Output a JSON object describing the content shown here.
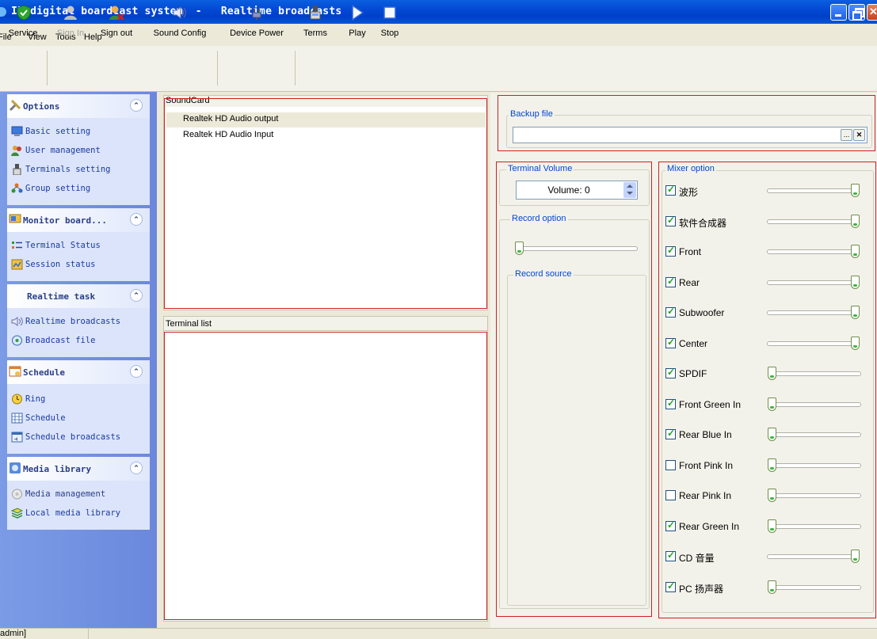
{
  "window": {
    "title": "IP digital boardcast system  -   Realtime broadcasts"
  },
  "menu": [
    "File",
    "View",
    "Tools",
    "Help"
  ],
  "toolbar": {
    "service": "Service",
    "sign_in": "Sign In",
    "sign_out": "Sign out",
    "sound_config": "Sound Config",
    "device_power": "Device Power",
    "terms": "Terms",
    "play": "Play",
    "stop": "Stop"
  },
  "sidebar": {
    "groups": [
      {
        "title": "Options",
        "items": [
          "Basic setting",
          "User management",
          "Terminals setting",
          "Group setting"
        ]
      },
      {
        "title": "Monitor board...",
        "items": [
          "Terminal Status",
          "Session status"
        ]
      },
      {
        "title": "Realtime task",
        "items": [
          "Realtime broadcasts",
          "Broadcast file"
        ]
      },
      {
        "title": "Schedule",
        "items": [
          "Ring",
          "Schedule",
          "Schedule broadcasts"
        ]
      },
      {
        "title": "Media library",
        "items": [
          "Media management",
          "Local media library"
        ]
      }
    ]
  },
  "soundcard": {
    "header": "SoundCard",
    "items": [
      "Realtek HD Audio output",
      "Realtek HD Audio Input"
    ]
  },
  "terminal_list": {
    "header": "Terminal list"
  },
  "backup": {
    "legend": "Backup file",
    "value": "",
    "browse_label": "...",
    "clear_label": "✕"
  },
  "terminal_volume": {
    "legend": "Terminal Volume",
    "value": "Volume: 0"
  },
  "record": {
    "legend": "Record option",
    "level": 0,
    "source_legend": "Record source"
  },
  "mixer": {
    "legend": "Mixer option",
    "channels": [
      {
        "label": "波形",
        "checked": true,
        "level": 1.0
      },
      {
        "label": "软件合成器",
        "checked": true,
        "level": 1.0
      },
      {
        "label": "Front",
        "checked": true,
        "level": 1.0
      },
      {
        "label": "Rear",
        "checked": true,
        "level": 1.0
      },
      {
        "label": "Subwoofer",
        "checked": true,
        "level": 1.0
      },
      {
        "label": "Center",
        "checked": true,
        "level": 1.0
      },
      {
        "label": "SPDIF",
        "checked": true,
        "level": 0.0
      },
      {
        "label": "Front Green In",
        "checked": true,
        "level": 0.0
      },
      {
        "label": "Rear Blue In",
        "checked": true,
        "level": 0.0
      },
      {
        "label": "Front Pink In",
        "checked": false,
        "level": 0.0
      },
      {
        "label": "Rear Pink In",
        "checked": false,
        "level": 0.0
      },
      {
        "label": "Rear Green In",
        "checked": true,
        "level": 0.0
      },
      {
        "label": "CD 音量",
        "checked": true,
        "level": 1.0
      },
      {
        "label": "PC 扬声器",
        "checked": true,
        "level": 0.0
      }
    ]
  },
  "statusbar": {
    "user": "admin]"
  }
}
